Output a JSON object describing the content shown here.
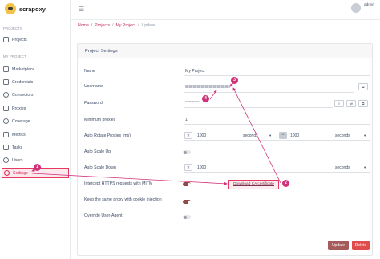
{
  "app": {
    "logo_text": "scrapoxy"
  },
  "topbar": {
    "user_name": "admin"
  },
  "sidebar": {
    "projects_section": "PROJECTS",
    "my_project_section": "MY PROJECT",
    "items": [
      {
        "label": "Projects",
        "icon": "projects-icon"
      },
      {
        "label": "Marketplace",
        "icon": "marketplace-icon"
      },
      {
        "label": "Credentials",
        "icon": "credentials-icon"
      },
      {
        "label": "Connectors",
        "icon": "connectors-icon"
      },
      {
        "label": "Proxies",
        "icon": "proxies-icon"
      },
      {
        "label": "Coverage",
        "icon": "coverage-icon"
      },
      {
        "label": "Metrics",
        "icon": "metrics-icon"
      },
      {
        "label": "Tasks",
        "icon": "tasks-icon"
      },
      {
        "label": "Users",
        "icon": "users-icon"
      },
      {
        "label": "Settings",
        "icon": "gear-icon"
      }
    ]
  },
  "breadcrumb": {
    "home": "Home",
    "projects": "Projects",
    "project": "My Project",
    "current": "Update",
    "sep": "/"
  },
  "form": {
    "title": "Project Settings",
    "name_label": "Name",
    "name_value": "My Project",
    "username_label": "Username",
    "password_label": "Password",
    "password_value": "••••••••••••",
    "min_proxies_label": "Minimum proxies",
    "min_proxies_value": "1",
    "auto_rotate_label": "Auto Rotate Proxies (ms)",
    "rotate_min_value": "1000",
    "rotate_min_unit": "seconds",
    "rotate_max_value": "1000",
    "rotate_max_unit": "seconds",
    "auto_scale_up_label": "Auto Scale Up",
    "auto_scale_up_on": false,
    "auto_scale_down_label": "Auto Scale Down",
    "scale_down_value": "1000",
    "scale_down_unit": "seconds",
    "mitm_label": "Intercept HTTPS requests with MITM",
    "mitm_on": true,
    "download_ca": "Download CA certificate",
    "cookie_label": "Keep the same proxy with cookie injection",
    "cookie_on": true,
    "override_ua_label": "Override User-Agent",
    "override_ua_on": false,
    "update_button": "Update",
    "delete_button": "Delete",
    "x_glyph": "✕",
    "minus_glyph": "−",
    "caret_glyph": "▾"
  },
  "annotations": {
    "b1": "1",
    "b2": "2",
    "b3": "3",
    "b4": "4"
  },
  "colors": {
    "accent": "#d0327a",
    "update": "#a65b5b",
    "delete": "#e04b4b",
    "toggle_on": "#8c4a4a"
  }
}
